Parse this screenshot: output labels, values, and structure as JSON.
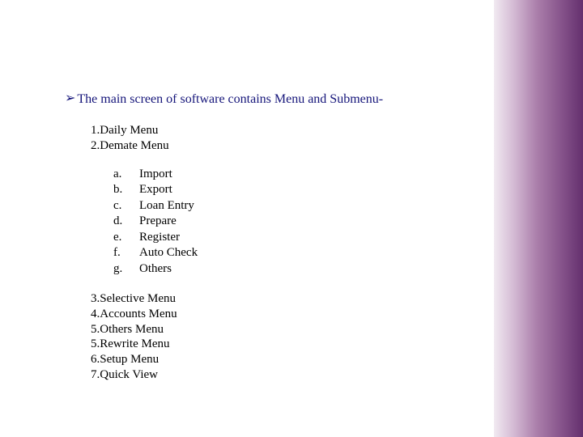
{
  "heading": "The main screen of software contains Menu and Submenu-",
  "menus_top": [
    "1.Daily Menu",
    "2.Demate Menu"
  ],
  "submenu": [
    {
      "mark": "a.",
      "label": "Import"
    },
    {
      "mark": "b.",
      "label": "Export"
    },
    {
      "mark": "c.",
      "label": "Loan Entry"
    },
    {
      "mark": "d.",
      "label": "Prepare"
    },
    {
      "mark": "e.",
      "label": "Register"
    },
    {
      "mark": "f.",
      "label": " Auto Check"
    },
    {
      "mark": "g.",
      "label": "Others"
    }
  ],
  "menus_bottom": [
    "3.Selective Menu",
    "4.Accounts Menu",
    "5.Others Menu",
    "5.Rewrite Menu",
    "6.Setup Menu",
    "7.Quick View"
  ]
}
